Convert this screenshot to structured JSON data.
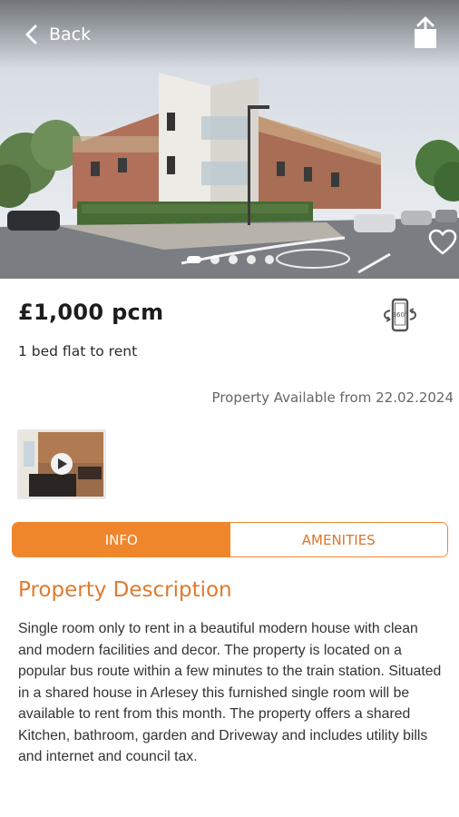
{
  "header": {
    "back_label": "Back",
    "carousel": {
      "count": 5,
      "active_index": 0
    }
  },
  "listing": {
    "price": "£1,000 pcm",
    "subtitle": "1 bed flat to rent",
    "availability": "Property Available from 22.02.2024",
    "vr_badge": "360°"
  },
  "tabs": [
    {
      "label": "INFO",
      "active": true
    },
    {
      "label": "AMENITIES",
      "active": false
    }
  ],
  "description": {
    "title": "Property Description",
    "body": "Single room only to rent in a beautiful modern house with clean and modern facilities and decor. The property is located on a popular bus route within a few minutes to the train station. Situated in a shared house in Arlesey this furnished single room will be available to rent from this month. The property offers a shared Kitchen, bathroom, garden and Driveway and includes utility bills and internet and council tax."
  },
  "colors": {
    "accent": "#f0862c",
    "accent_text": "#e07a2e"
  },
  "icons": {
    "back": "chevron-left-icon",
    "share": "share-icon",
    "favorite": "heart-icon",
    "vr": "360-view-icon",
    "play": "play-icon"
  }
}
